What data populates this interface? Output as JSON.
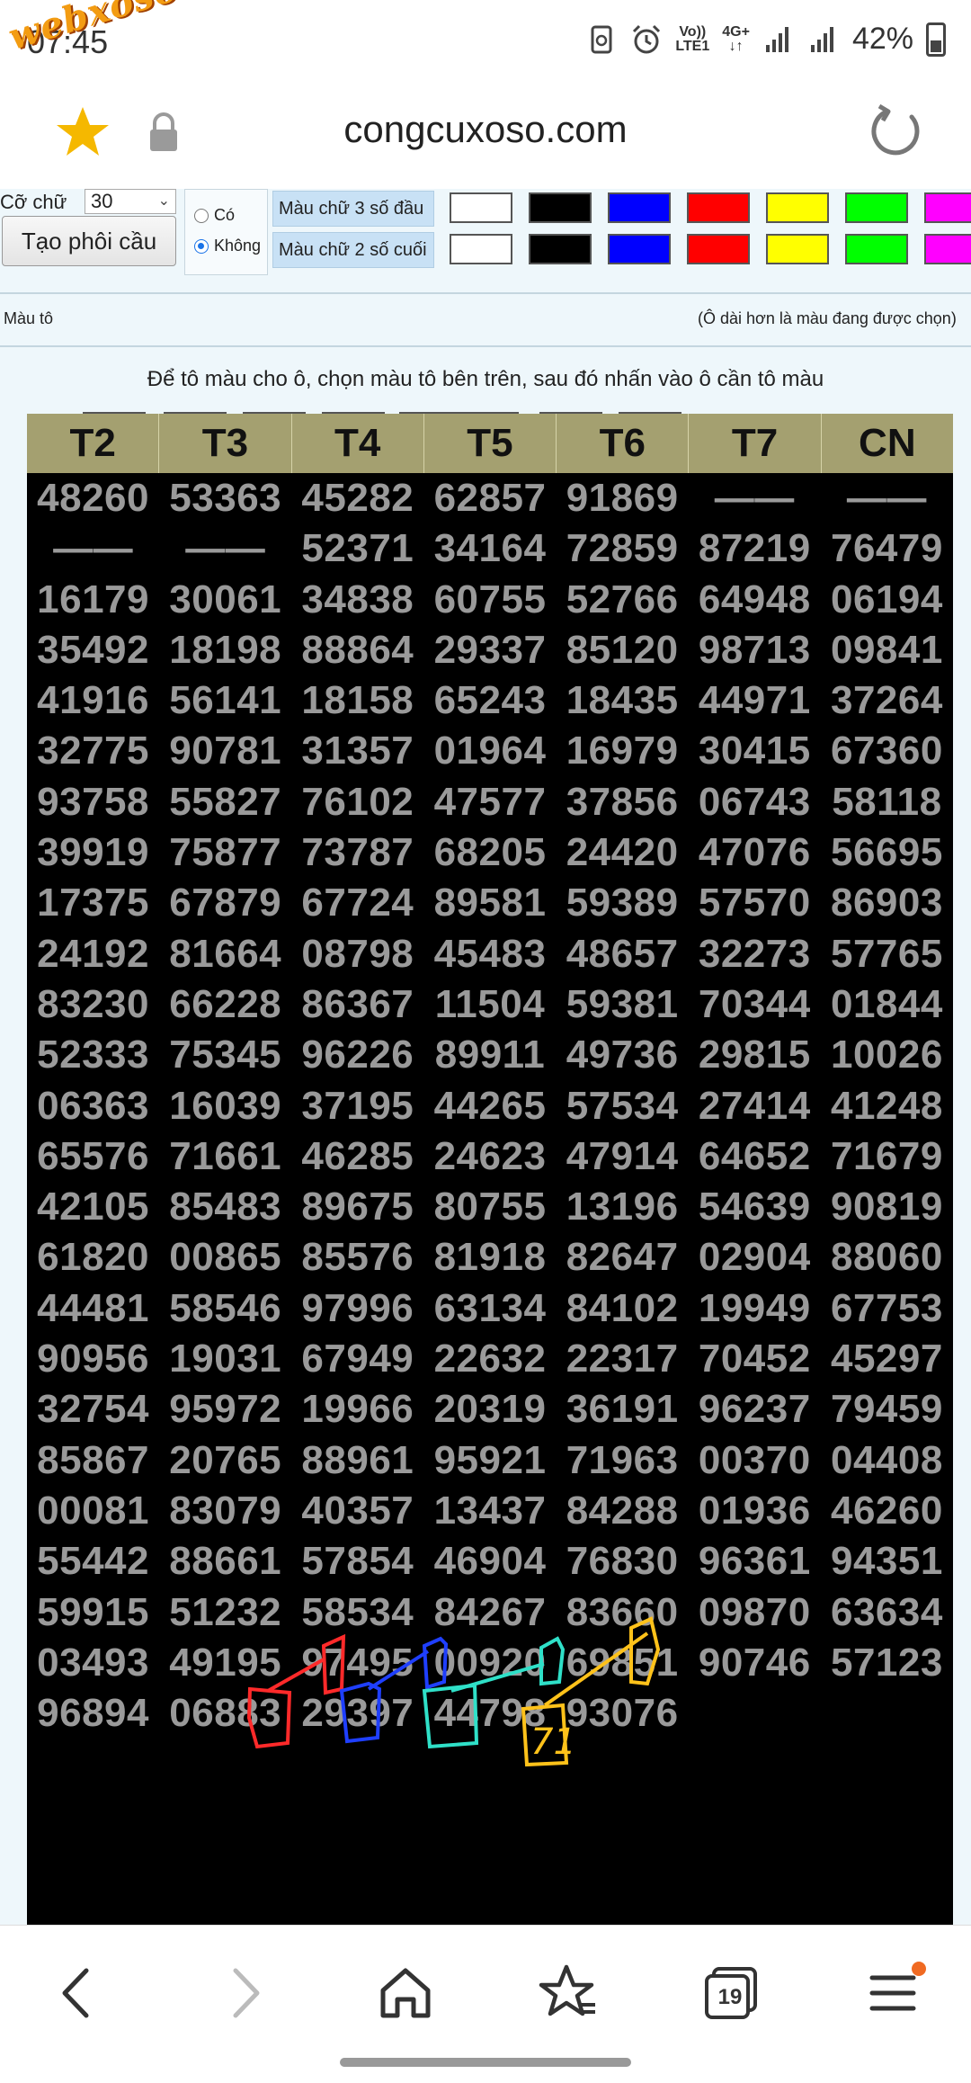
{
  "status_bar": {
    "time": "07:45",
    "watermark": "webxoso.net",
    "network_top": "Vo))",
    "network_bottom": "LTE1",
    "network_type": "4G+",
    "battery": "42%"
  },
  "browser": {
    "url": "congcuxoso.com",
    "tab_count": "19"
  },
  "controls": {
    "co_chu_label": "Cỡ chữ",
    "co_chu_value": "30",
    "tao_phoi_cau_label": "Tạo phôi cầu",
    "radio_co": "Có",
    "radio_khong": "Không",
    "mau_chu_3_label": "Màu chữ 3 số đầu",
    "mau_chu_2_label": "Màu chữ 2 số cuối",
    "mau_to_label": "Màu tô",
    "mau_to_hint": "(Ô dài hơn là màu đang được chọn)",
    "instruction": "Để tô màu cho ô, chọn màu tô bên trên, sau đó nhấn vào ô cần tô màu",
    "palette": [
      "#ffffff",
      "#000000",
      "#0000ff",
      "#ff0000",
      "#ffff00",
      "#00ff00",
      "#ff00ff"
    ]
  },
  "table": {
    "headers": [
      "T2",
      "T3",
      "T4",
      "T5",
      "T6",
      "T7",
      "CN"
    ],
    "rows": [
      [
        "48260",
        "53363",
        "45282",
        "62857",
        "91869",
        "——",
        "——"
      ],
      [
        "——",
        "——",
        "52371",
        "34164",
        "72859",
        "87219",
        "76479"
      ],
      [
        "16179",
        "30061",
        "34838",
        "60755",
        "52766",
        "64948",
        "06194"
      ],
      [
        "35492",
        "18198",
        "88864",
        "29337",
        "85120",
        "98713",
        "09841"
      ],
      [
        "41916",
        "56141",
        "18158",
        "65243",
        "18435",
        "44971",
        "37264"
      ],
      [
        "32775",
        "90781",
        "31357",
        "01964",
        "16979",
        "30415",
        "67360"
      ],
      [
        "93758",
        "55827",
        "76102",
        "47577",
        "37856",
        "06743",
        "58118"
      ],
      [
        "39919",
        "75877",
        "73787",
        "68205",
        "24420",
        "47076",
        "56695"
      ],
      [
        "17375",
        "67879",
        "67724",
        "89581",
        "59389",
        "57570",
        "86903"
      ],
      [
        "24192",
        "81664",
        "08798",
        "45483",
        "48657",
        "32273",
        "57765"
      ],
      [
        "83230",
        "66228",
        "86367",
        "11504",
        "59381",
        "70344",
        "01844"
      ],
      [
        "52333",
        "75345",
        "96226",
        "89911",
        "49736",
        "29815",
        "10026"
      ],
      [
        "06363",
        "16039",
        "37195",
        "44265",
        "57534",
        "27414",
        "41248"
      ],
      [
        "65576",
        "71661",
        "46285",
        "24623",
        "47914",
        "64652",
        "71679"
      ],
      [
        "42105",
        "85483",
        "89675",
        "80755",
        "13196",
        "54639",
        "90819"
      ],
      [
        "61820",
        "00865",
        "85576",
        "81918",
        "82647",
        "02904",
        "88060"
      ],
      [
        "44481",
        "58546",
        "97996",
        "63134",
        "84102",
        "19949",
        "67753"
      ],
      [
        "90956",
        "19031",
        "67949",
        "22632",
        "22317",
        "70452",
        "45297"
      ],
      [
        "32754",
        "95972",
        "19966",
        "20319",
        "36191",
        "96237",
        "79459"
      ],
      [
        "85867",
        "20765",
        "88961",
        "95921",
        "71963",
        "00370",
        "04408"
      ],
      [
        "00081",
        "83079",
        "40357",
        "13437",
        "84288",
        "01936",
        "46260"
      ],
      [
        "55442",
        "88661",
        "57854",
        "46904",
        "76830",
        "96361",
        "94351"
      ],
      [
        "59915",
        "51232",
        "58534",
        "84267",
        "83660",
        "09870",
        "63634"
      ],
      [
        "03493",
        "49195",
        "97495",
        "00920",
        "69851",
        "90746",
        "57123"
      ],
      [
        "96894",
        "06883",
        "29397",
        "44798",
        "93076",
        "",
        ""
      ]
    ]
  },
  "annotation": {
    "handwritten_text": "71",
    "colors": [
      "#ff2a2a",
      "#1f3fff",
      "#2fe0c8",
      "#ffc21a"
    ]
  }
}
